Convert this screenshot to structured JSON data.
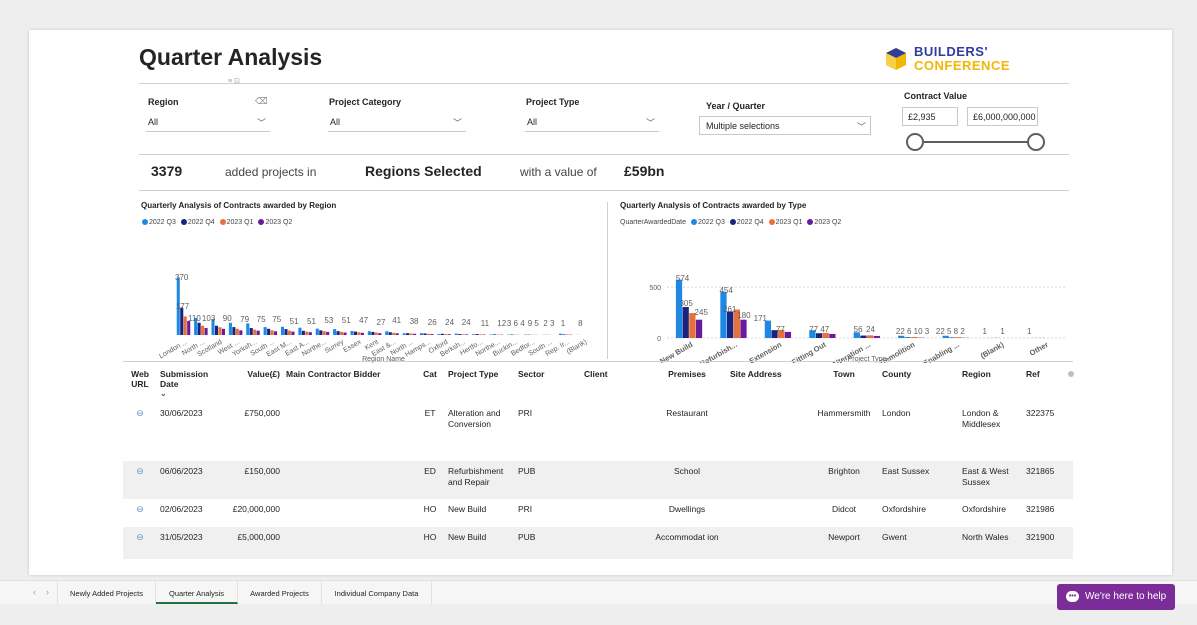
{
  "page": {
    "title": "Quarter Analysis",
    "logo": {
      "line1": "BUILDERS'",
      "line2": "CONFERENCE"
    }
  },
  "filters": {
    "region": {
      "label": "Region",
      "value": "All"
    },
    "project_category": {
      "label": "Project Category",
      "value": "All"
    },
    "project_type": {
      "label": "Project Type",
      "value": "All"
    },
    "year_quarter": {
      "label": "Year / Quarter",
      "value": "Multiple selections"
    },
    "contract_value": {
      "label": "Contract Value",
      "min": "£2,935",
      "max": "£6,000,000,000"
    }
  },
  "kpi": {
    "count": "3379",
    "text1": "added projects in",
    "regions": "Regions Selected",
    "text2": "with a value of",
    "value": "£59bn"
  },
  "colors": {
    "q2022_3": "#1e88e5",
    "q2022_4": "#1a237e",
    "q2023_1": "#e8703a",
    "q2023_2": "#6a1b9a",
    "accent": "#217346",
    "help": "#7b2c99"
  },
  "chart_data": [
    {
      "type": "bar",
      "title": "Quarterly Analysis of Contracts awarded by Region",
      "xlabel": "Region Name",
      "ylabel": "",
      "legend_position": "top-left",
      "ylim": [
        0,
        400
      ],
      "categories": [
        "London ...",
        "North ...",
        "Scotland",
        "West ...",
        "Yorksh...",
        "South ...",
        "East M...",
        "East A...",
        "Northe...",
        "Surrey",
        "Essex",
        "Kent",
        "East &...",
        "North ...",
        "Hamps...",
        "Oxford",
        "Berksh...",
        "Hertfo...",
        "Northe...",
        "Buckin...",
        "Bedfor...",
        "South ...",
        "Rep. Ir...",
        "(Blank)"
      ],
      "labels": [
        "370",
        "177",
        "110",
        "103",
        "90",
        "79",
        "75",
        "75",
        "51",
        "51",
        "53",
        "51",
        "47",
        "27",
        "41",
        "38",
        "26",
        "24",
        "24",
        "11",
        "12",
        "3 6 4",
        "9 5",
        "2 3",
        "1",
        "8"
      ],
      "series": [
        {
          "name": "2022 Q3",
          "values": [
            370,
            110,
            103,
            79,
            75,
            51,
            53,
            47,
            41,
            38,
            26,
            24,
            24,
            11,
            12,
            6,
            9,
            5,
            3,
            2,
            3,
            1,
            8,
            1
          ]
        },
        {
          "name": "2022 Q4",
          "values": [
            177,
            79,
            60,
            51,
            45,
            40,
            38,
            27,
            30,
            25,
            22,
            20,
            18,
            12,
            10,
            8,
            6,
            6,
            4,
            3,
            2,
            1,
            4,
            0
          ]
        },
        {
          "name": "2023 Q1",
          "values": [
            120,
            60,
            50,
            40,
            35,
            30,
            28,
            22,
            25,
            20,
            18,
            16,
            14,
            10,
            8,
            6,
            5,
            4,
            3,
            2,
            1,
            1,
            3,
            0
          ]
        },
        {
          "name": "2023 Q2",
          "values": [
            90,
            45,
            40,
            30,
            28,
            24,
            22,
            18,
            20,
            16,
            14,
            12,
            11,
            8,
            6,
            5,
            4,
            3,
            2,
            1,
            1,
            0,
            2,
            0
          ]
        }
      ]
    },
    {
      "type": "bar",
      "title": "Quarterly Analysis of Contracts awarded by Type",
      "xlabel": "Project Type",
      "ylabel": "",
      "legend_title": "QuarterAwardedDate",
      "legend_position": "top-left",
      "ylim": [
        0,
        600
      ],
      "yticks": [
        "0",
        "500"
      ],
      "categories": [
        "New Build",
        "Refurbish...",
        "Extension",
        "Fitting Out",
        "Alteration ...",
        "Demolition",
        "Enabling ...",
        "(Blank)",
        "Other"
      ],
      "series": [
        {
          "name": "2022 Q3",
          "values": [
            574,
            454,
            171,
            77,
            56,
            22,
            22,
            1,
            1
          ]
        },
        {
          "name": "2022 Q4",
          "values": [
            305,
            261,
            77,
            47,
            24,
            6,
            5,
            1,
            1
          ]
        },
        {
          "name": "2023 Q1",
          "values": [
            245,
            280,
            80,
            50,
            26,
            10,
            8,
            0,
            0
          ]
        },
        {
          "name": "2023 Q2",
          "values": [
            180,
            180,
            60,
            40,
            20,
            3,
            2,
            0,
            0
          ]
        }
      ],
      "labels": [
        "574",
        "305",
        "245",
        "454",
        "261",
        "180",
        "171",
        "77",
        "77",
        "47",
        "56",
        "24",
        "22 6 10 3",
        "22 5 8 2",
        "1",
        "1",
        "1"
      ]
    }
  ],
  "table": {
    "headers": [
      "Web URL",
      "Submission Date",
      "Value(£)",
      "Main Contractor Bidder",
      "Cat",
      "Project Type",
      "Sector",
      "Client",
      "Premises",
      "Site Address",
      "Town",
      "County",
      "Region",
      "Ref"
    ],
    "rows": [
      [
        "",
        "30/06/2023",
        "£750,000",
        "",
        "ET",
        "Alteration and Conversion",
        "PRI",
        "",
        "Restaurant",
        "",
        "Hammersmith",
        "London",
        "London & Middlesex",
        "322375"
      ],
      [
        "",
        "06/06/2023",
        "£150,000",
        "",
        "ED",
        "Refurbishment and Repair",
        "PUB",
        "",
        "School",
        "",
        "Brighton",
        "East Sussex",
        "East & West Sussex",
        "321865"
      ],
      [
        "",
        "02/06/2023",
        "£20,000,000",
        "",
        "HO",
        "New Build",
        "PRI",
        "",
        "Dwellings",
        "",
        "Didcot",
        "Oxfordshire",
        "Oxfordshire",
        "321986"
      ],
      [
        "",
        "31/05/2023",
        "£5,000,000",
        "",
        "HO",
        "New Build",
        "PUB",
        "",
        "Accommodat ion",
        "",
        "Newport",
        "Gwent",
        "North Wales",
        "321900"
      ]
    ]
  },
  "tabs": [
    "Newly Added Projects",
    "Quarter Analysis",
    "Awarded Projects",
    "Individual Company Data"
  ],
  "active_tab": "Quarter Analysis",
  "help": {
    "label": "We're here to help"
  }
}
